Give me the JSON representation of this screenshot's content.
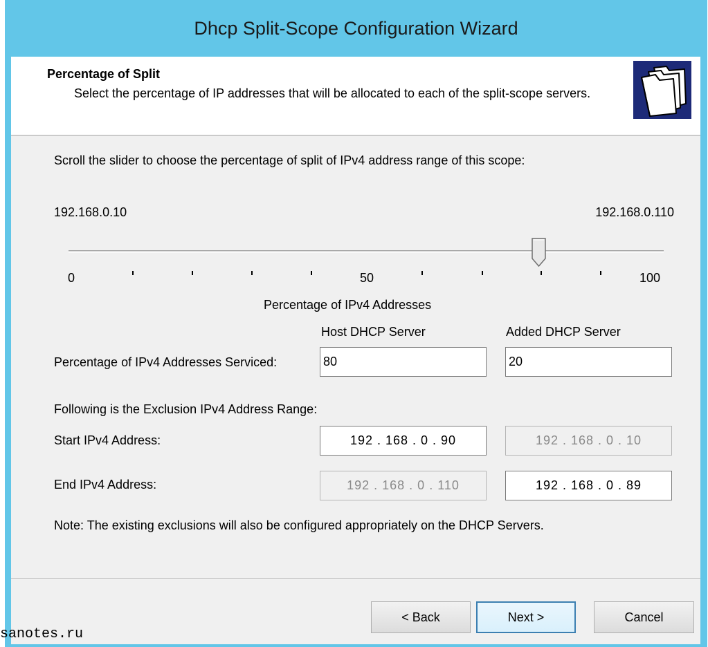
{
  "window": {
    "title": "Dhcp Split-Scope Configuration Wizard"
  },
  "header": {
    "title": "Percentage of Split",
    "subtitle": "Select the percentage of IP addresses that will be allocated to each of the split-scope servers."
  },
  "instructions": "Scroll the slider to choose the percentage of split of IPv4 address range of this scope:",
  "range": {
    "start": "192.168.0.10",
    "end": "192.168.0.110"
  },
  "slider": {
    "value_percent": 80,
    "labels": {
      "min": "0",
      "mid": "50",
      "max": "100"
    },
    "caption": "Percentage of IPv4 Addresses"
  },
  "columns": {
    "host": "Host DHCP Server",
    "added": "Added DHCP Server"
  },
  "serviced": {
    "label": "Percentage of IPv4 Addresses Serviced:",
    "host_value": "80",
    "added_value": "20"
  },
  "exclusion": {
    "heading": "Following is the Exclusion IPv4 Address Range:",
    "start_label": "Start IPv4 Address:",
    "end_label": "End IPv4 Address:",
    "host_start": "192 . 168 .  0  .  90",
    "added_start": "192 . 168 .  0  .  10",
    "host_end": "192 . 168 .  0  . 110",
    "added_end": "192 . 168 .  0  .  89"
  },
  "note": "Note: The existing exclusions will also be configured appropriately on the DHCP Servers.",
  "buttons": {
    "back": "< Back",
    "next": "Next >",
    "cancel": "Cancel"
  },
  "watermark": "sanotes.ru",
  "colors": {
    "titlebar": "#62c6e8",
    "client": "#f0f0f0",
    "icon_bg": "#1d2a78"
  }
}
